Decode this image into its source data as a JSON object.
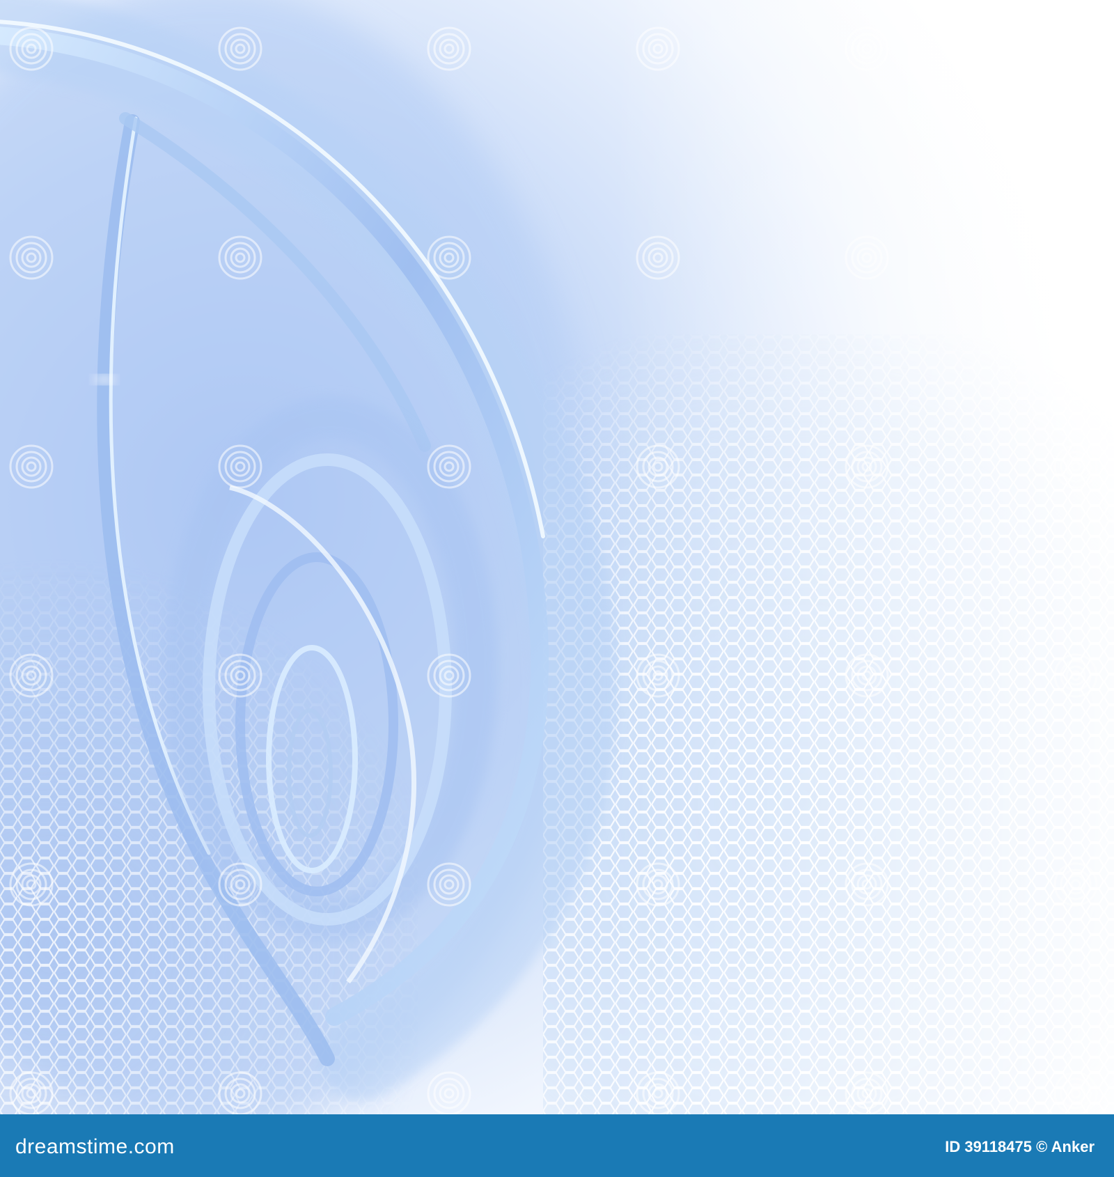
{
  "image": {
    "subject": "abstract-blue-swirl-background",
    "palette": {
      "deep_blue": "#8fb2ef",
      "mid_blue": "#b7d0f7",
      "light_blue": "#e6f0fd",
      "highlight": "#f4fbff",
      "mesh": "#9ec4f0",
      "background": "#ffffff",
      "footer": "#1a7ab5"
    },
    "watermark_text": "dreamstime"
  },
  "footer": {
    "brand": "dreamstime.com",
    "id_label": "ID",
    "id_value": "39118475",
    "copyright_symbol": "©",
    "author": "Anker"
  }
}
